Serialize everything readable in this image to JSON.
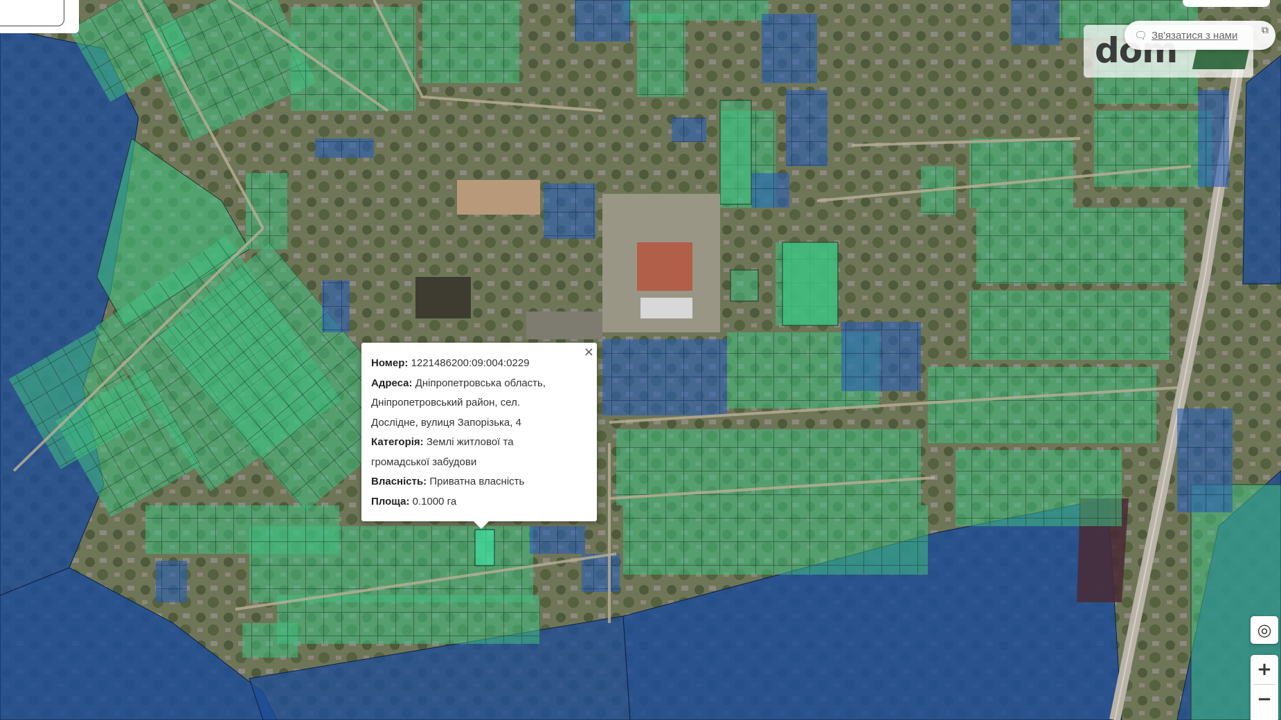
{
  "popup": {
    "close_label": "×",
    "number_label": "Номер:",
    "number_value": "1221486200:09:004:0229",
    "address_label": "Адреса:",
    "address_line1": "Дніпропетровська область,",
    "address_line2": "Дніпропетровський район, сел.",
    "address_line3": "Дослідне, вулиця Запорізька, 4",
    "category_label": "Категорія:",
    "category_line1": "Землі житлової та",
    "category_line2": "громадської забудови",
    "ownership_label": "Власність:",
    "ownership_value": "Приватна власність",
    "area_label": "Площа:",
    "area_value": "0.1000 га"
  },
  "header": {
    "logo_text": "dom",
    "contact_label": "Зв'язатися з нами",
    "contact_icon": "chat-icon",
    "external_icon": "external-link-icon"
  },
  "controls": {
    "locate_icon": "◎",
    "zoom_in": "+",
    "zoom_out": "−"
  },
  "colors": {
    "parcel_green": "#3fbf7f",
    "parcel_blue": "#2a5fb8",
    "farmland_blue": "#1f4d96"
  }
}
